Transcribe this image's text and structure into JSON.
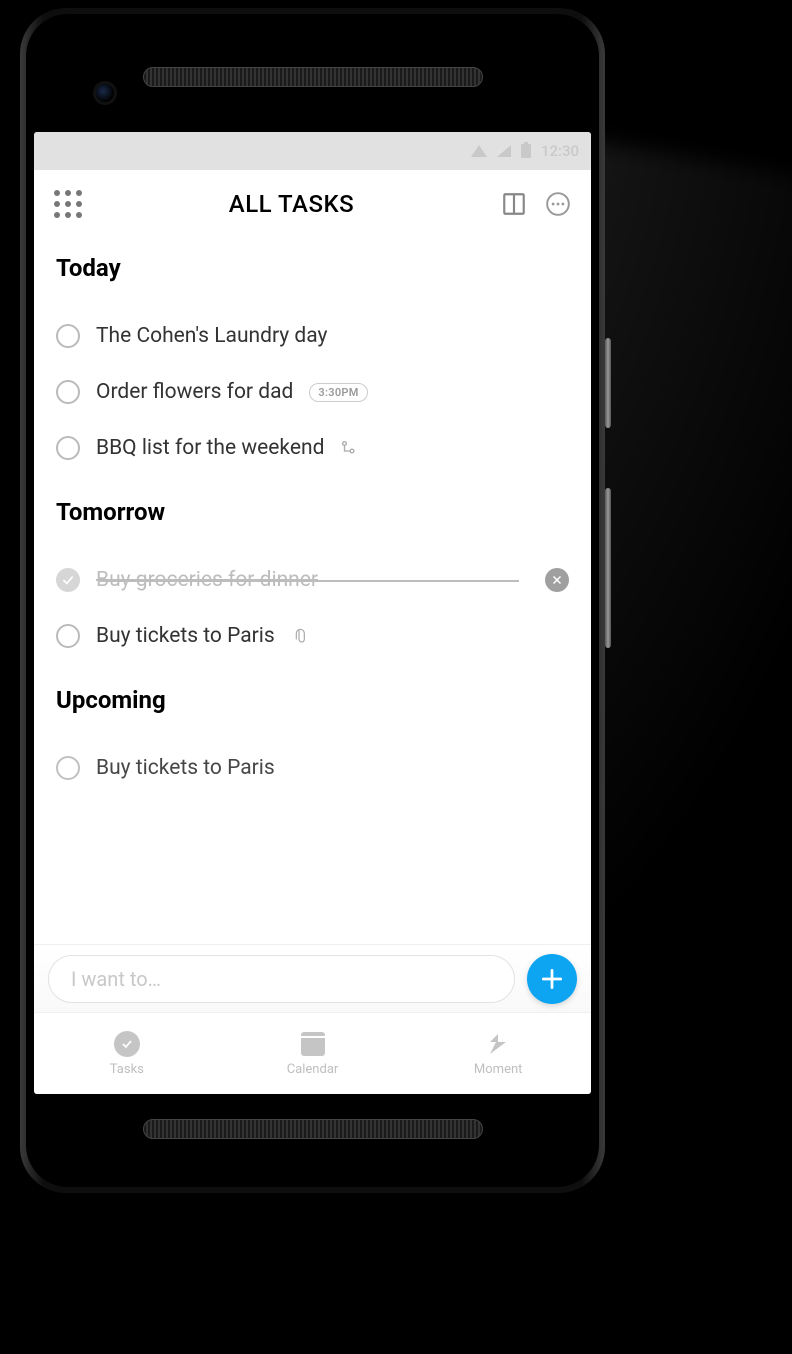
{
  "statusbar": {
    "time": "12:30"
  },
  "header": {
    "title": "ALL TASKS"
  },
  "sections": {
    "today": {
      "title": "Today",
      "tasks": [
        {
          "text": "The Cohen's Laundry day"
        },
        {
          "text": "Order flowers for dad",
          "time": "3:30PM"
        },
        {
          "text": "BBQ list for the weekend",
          "has_subtasks": true
        }
      ]
    },
    "tomorrow": {
      "title": "Tomorrow",
      "tasks": [
        {
          "text": "Buy groceries for dinner",
          "done": true
        },
        {
          "text": "Buy tickets to Paris",
          "has_attachment": true
        }
      ]
    },
    "upcoming": {
      "title": "Upcoming",
      "tasks": [
        {
          "text": "Buy tickets to Paris"
        }
      ]
    }
  },
  "input": {
    "placeholder": "I want to…"
  },
  "nav": {
    "tasks": "Tasks",
    "calendar": "Calendar",
    "moment": "Moment"
  },
  "colors": {
    "accent": "#0da5f2"
  }
}
